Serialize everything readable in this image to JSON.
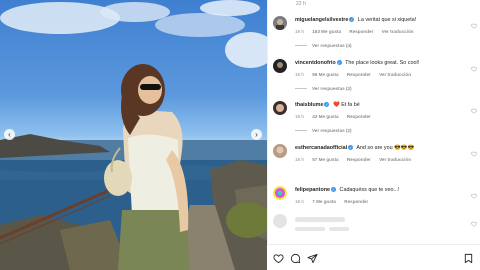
{
  "post": {
    "top_time": "22 h",
    "photo_alt": "Photo of a woman with sunglasses on rocky coast by the sea"
  },
  "comments": [
    {
      "username": "miguelangelsilvestre",
      "verified": true,
      "text": "La veritat que si xiqueta!",
      "time": "19 h",
      "likes": "163 Me gusta",
      "reply": "Responder",
      "translate": "Ver traducción",
      "replies": "Ver respuestas (4)"
    },
    {
      "username": "vincentdonofrio",
      "verified": true,
      "text": "The place looks great. So cool!",
      "time": "19 h",
      "likes": "56 Me gusta",
      "reply": "Responder",
      "translate": "Ver traducción",
      "replies": "Ver respuestas (2)"
    },
    {
      "username": "thaisblume",
      "verified": true,
      "text": "Et fa bé",
      "emoji": "❤️",
      "time": "19 h",
      "likes": "43 Me gusta",
      "reply": "Responder",
      "replies": "Ver respuestas (2)"
    },
    {
      "username": "esthercanadaofficial",
      "verified": true,
      "text": "And so are you",
      "emoji": "😎😎😎",
      "time": "18 h",
      "likes": "57 Me gusta",
      "reply": "Responder",
      "translate": "Ver traducción"
    },
    {
      "username": "felipepantone",
      "verified": true,
      "text": "Cadaquéss que te veo...!",
      "time": "19 h",
      "likes": "7 Me gusta",
      "reply": "Responder"
    }
  ],
  "icons": {
    "like": "heart-icon",
    "comment": "comment-icon",
    "share": "paper-plane-icon",
    "save": "bookmark-icon"
  }
}
